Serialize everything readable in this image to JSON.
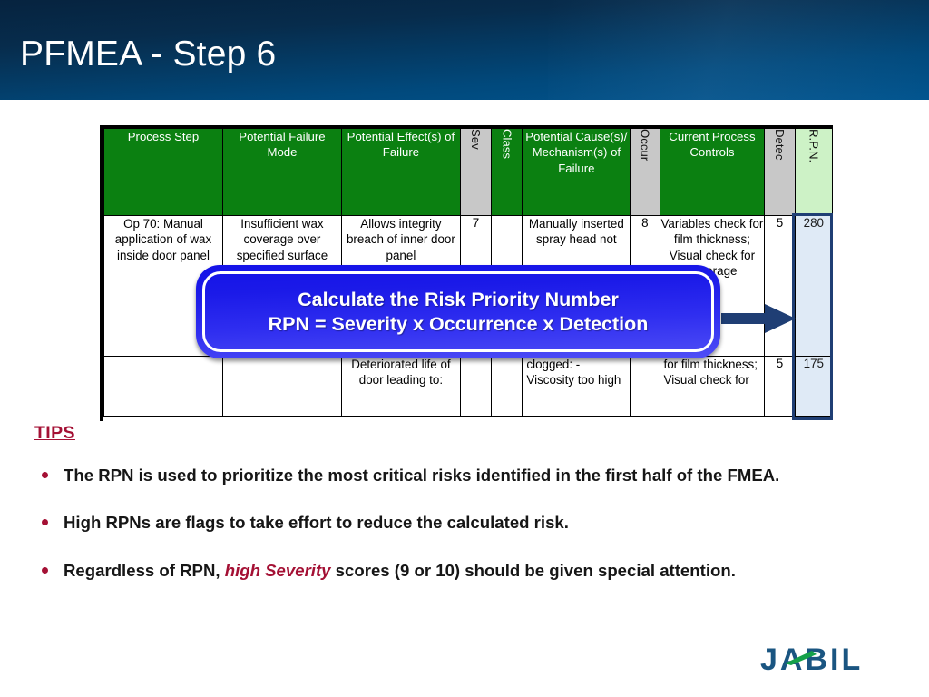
{
  "slide": {
    "title": "PFMEA - Step 6"
  },
  "table": {
    "headers": [
      {
        "label": "Process Step",
        "style": "green"
      },
      {
        "label": "Potential Failure Mode",
        "style": "green"
      },
      {
        "label": "Potential Effect(s) of Failure",
        "style": "green"
      },
      {
        "label": "Sev",
        "style": "gray-rotated"
      },
      {
        "label": "Class",
        "style": "green-rotated"
      },
      {
        "label": "Potential Cause(s)/ Mechanism(s) of Failure",
        "style": "green"
      },
      {
        "label": "Occur",
        "style": "gray-rotated"
      },
      {
        "label": "Current Process Controls",
        "style": "green"
      },
      {
        "label": "Detec",
        "style": "gray-rotated"
      },
      {
        "label": "R.P.N.",
        "style": "lightgreen-rotated"
      }
    ],
    "rows": [
      {
        "process_step": "Op 70: Manual application of wax inside door panel",
        "failure_mode": "Insufficient wax coverage over specified surface",
        "effect": "Allows integrity breach of inner door panel",
        "sev": "7",
        "class": "",
        "cause": "Manually inserted spray head not",
        "occur": "8",
        "controls": "Variables check for film thickness; Visual check for coverage",
        "detec": "5",
        "rpn": "280"
      },
      {
        "process_step": "",
        "failure_mode": "",
        "effect": "Deteriorated life of door leading to:",
        "sev": "",
        "class": "",
        "cause": "clogged: - Viscosity too high",
        "occur": "",
        "controls": "for film thickness; Visual check for",
        "detec": "5",
        "rpn": "175"
      }
    ]
  },
  "callout": {
    "line1": "Calculate the Risk Priority Number",
    "line2": "RPN = Severity x Occurrence x Detection"
  },
  "tips": {
    "heading": "TIPS",
    "items": [
      {
        "text": "The RPN is used to prioritize the most critical risks identified in the first half of the FMEA."
      },
      {
        "text": "High RPNs are flags to take effort to reduce the calculated risk."
      },
      {
        "prefix": "Regardless of RPN, ",
        "emphasis": "high Severity",
        "suffix": " scores (9 or 10) should be given special attention."
      }
    ]
  },
  "logo": {
    "text": "JABIL"
  },
  "colors": {
    "banner_dark": "#06233f",
    "banner_light": "#02558f",
    "header_green": "#0b8011",
    "header_gray": "#c8c8c8",
    "rpn_header_green": "#cdf2c6",
    "rpn_cell_blue": "#dfeaf6",
    "callout_blue": "#1b1ae8",
    "accent_crimson": "#a41034",
    "arrow_navy": "#1f3e74",
    "logo_blue": "#1a5581",
    "logo_green": "#14a04a"
  }
}
